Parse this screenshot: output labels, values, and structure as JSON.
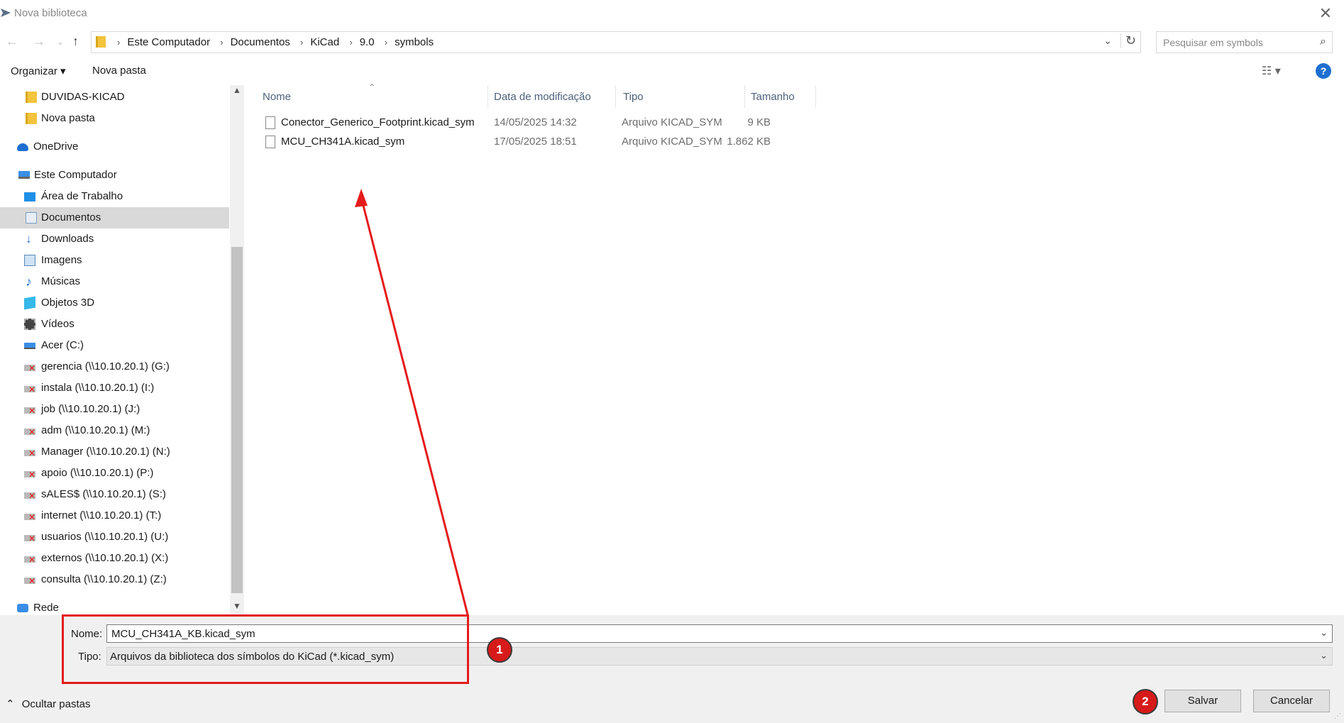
{
  "window": {
    "title": "Nova biblioteca"
  },
  "address": {
    "crumbs": [
      "Este Computador",
      "Documentos",
      "KiCad",
      "9.0",
      "symbols"
    ]
  },
  "search": {
    "placeholder": "Pesquisar em symbols"
  },
  "toolbar": {
    "organize": "Organizar ▾",
    "new_folder": "Nova pasta",
    "help": "?"
  },
  "nav": {
    "items": [
      {
        "label": "DUVIDAS-KICAD",
        "icon": "folder-icon"
      },
      {
        "label": "Nova pasta",
        "icon": "folder-icon"
      },
      {
        "label": "OneDrive",
        "icon": "cloud-icon"
      },
      {
        "label": "Este Computador",
        "icon": "computer-icon"
      },
      {
        "label": "Área de Trabalho",
        "icon": "desktop-icon"
      },
      {
        "label": "Documentos",
        "icon": "documents-icon"
      },
      {
        "label": "Downloads",
        "icon": "download-icon"
      },
      {
        "label": "Imagens",
        "icon": "pictures-icon"
      },
      {
        "label": "Músicas",
        "icon": "music-icon"
      },
      {
        "label": "Objetos 3D",
        "icon": "3d-objects-icon"
      },
      {
        "label": "Vídeos",
        "icon": "videos-icon"
      },
      {
        "label": "Acer (C:)",
        "icon": "drive-icon"
      },
      {
        "label": "gerencia (\\\\10.10.20.1) (G:)",
        "icon": "network-drive-disconnected-icon"
      },
      {
        "label": "instala (\\\\10.10.20.1) (I:)",
        "icon": "network-drive-disconnected-icon"
      },
      {
        "label": "job (\\\\10.10.20.1) (J:)",
        "icon": "network-drive-disconnected-icon"
      },
      {
        "label": "adm (\\\\10.10.20.1) (M:)",
        "icon": "network-drive-disconnected-icon"
      },
      {
        "label": "Manager (\\\\10.10.20.1) (N:)",
        "icon": "network-drive-disconnected-icon"
      },
      {
        "label": "apoio (\\\\10.10.20.1) (P:)",
        "icon": "network-drive-disconnected-icon"
      },
      {
        "label": "sALES$ (\\\\10.10.20.1) (S:)",
        "icon": "network-drive-disconnected-icon"
      },
      {
        "label": "internet (\\\\10.10.20.1) (T:)",
        "icon": "network-drive-disconnected-icon"
      },
      {
        "label": "usuarios (\\\\10.10.20.1) (U:)",
        "icon": "network-drive-disconnected-icon"
      },
      {
        "label": "externos (\\\\10.10.20.1) (X:)",
        "icon": "network-drive-disconnected-icon"
      },
      {
        "label": "consulta (\\\\10.10.20.1) (Z:)",
        "icon": "network-drive-disconnected-icon"
      },
      {
        "label": "Rede",
        "icon": "network-icon"
      }
    ]
  },
  "files": {
    "columns": [
      "Nome",
      "Data de modificação",
      "Tipo",
      "Tamanho"
    ],
    "rows": [
      {
        "name": "Conector_Generico_Footprint.kicad_sym",
        "date": "14/05/2025 14:32",
        "type": "Arquivo KICAD_SYM",
        "size": "9 KB"
      },
      {
        "name": "MCU_CH341A.kicad_sym",
        "date": "17/05/2025 18:51",
        "type": "Arquivo KICAD_SYM",
        "size": "1.862 KB"
      }
    ]
  },
  "form": {
    "name_label": "Nome:",
    "name_value": "MCU_CH341A_KB.kicad_sym",
    "type_label": "Tipo:",
    "type_value": "Arquivos da biblioteca dos símbolos do KiCad (*.kicad_sym)"
  },
  "footer": {
    "hide_folders": "Ocultar pastas",
    "save": "Salvar",
    "cancel": "Cancelar"
  },
  "annotations": {
    "badge1": "1",
    "badge2": "2",
    "color": "#e51b1b"
  }
}
